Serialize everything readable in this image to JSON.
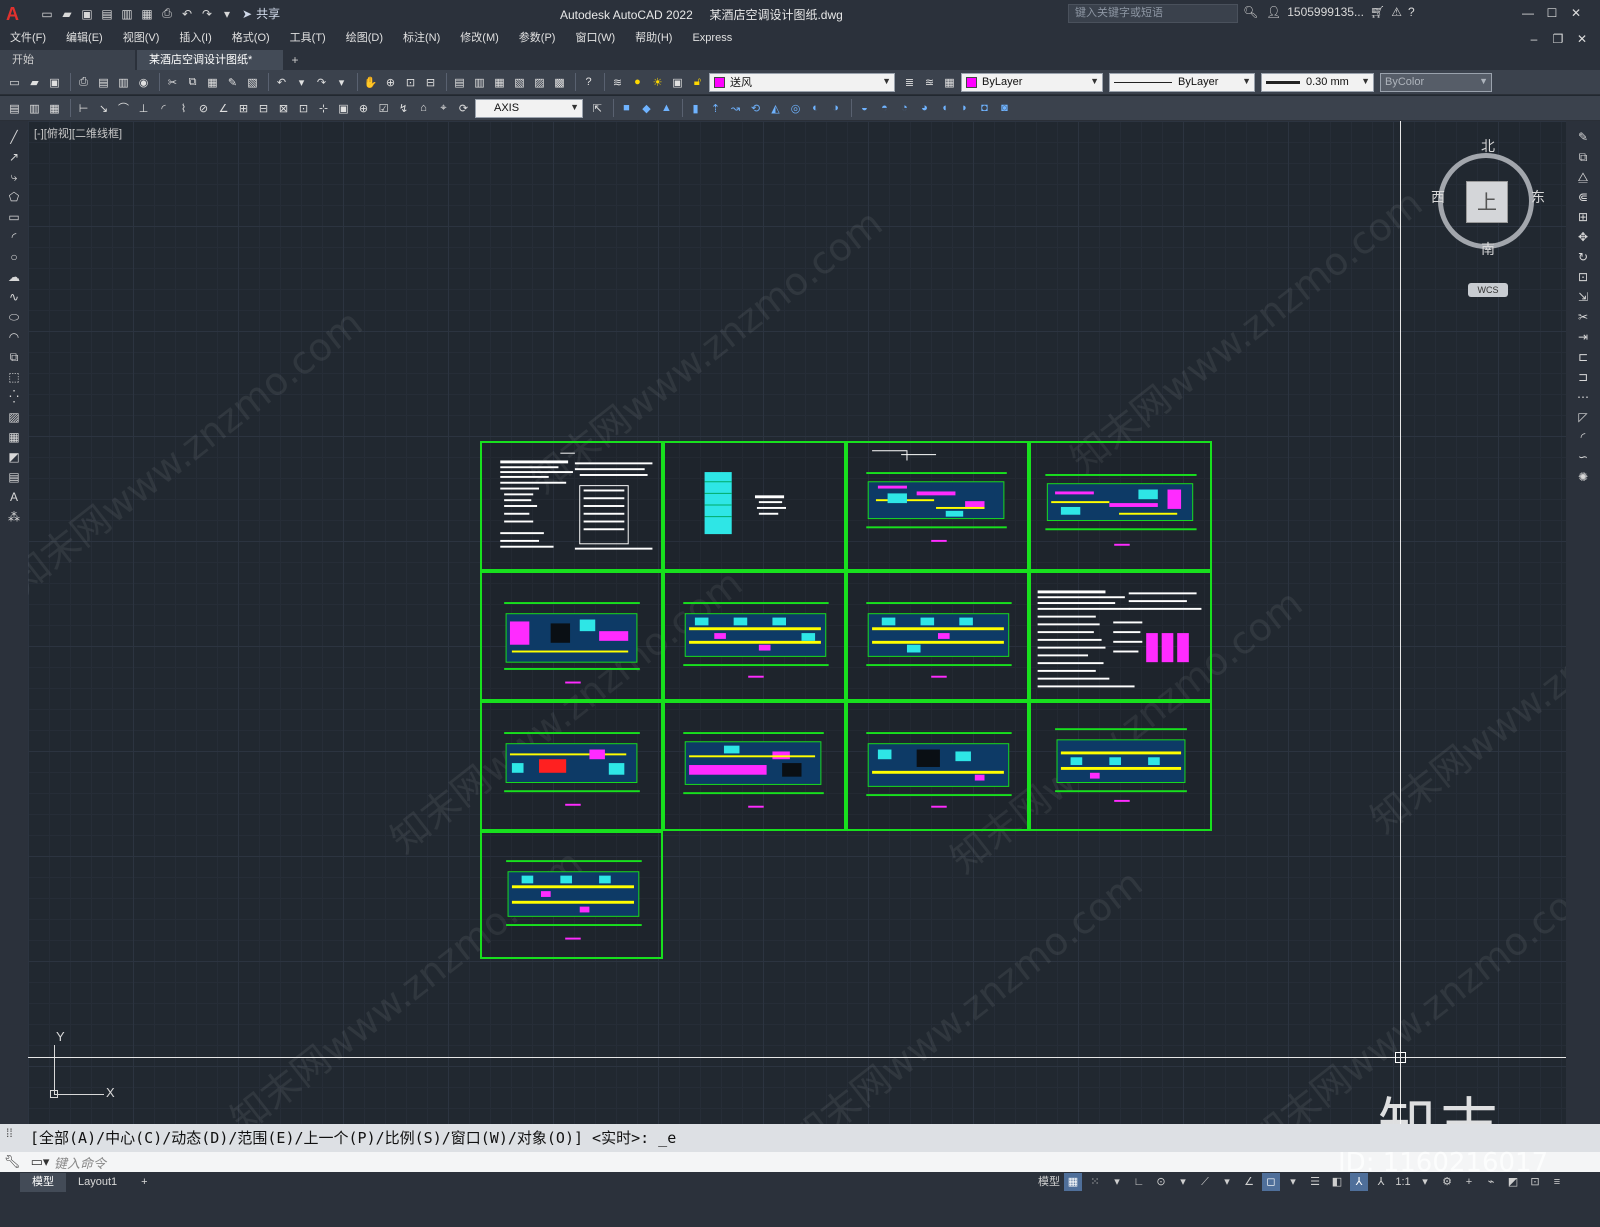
{
  "title_bar": {
    "app_title": "Autodesk AutoCAD 2022",
    "file_title": "某酒店空调设计图纸.dwg",
    "share_label": "共享",
    "search_placeholder": "键入关键字或短语",
    "user_name": "1505999135..."
  },
  "menu": {
    "items": [
      "文件(F)",
      "编辑(E)",
      "视图(V)",
      "插入(I)",
      "格式(O)",
      "工具(T)",
      "绘图(D)",
      "标注(N)",
      "修改(M)",
      "参数(P)",
      "窗口(W)",
      "帮助(H)",
      "Express"
    ]
  },
  "tabs": {
    "start": "开始",
    "active": "某酒店空调设计图纸*"
  },
  "properties": {
    "layer": "送风",
    "color": "ByLayer",
    "linetype": "ByLayer",
    "lineweight": "0.30 mm",
    "plotstyle": "ByColor",
    "dimstyle": "AXIS",
    "accent_color": "#ff00ff"
  },
  "viewport": {
    "label": "[-][俯视][二维线框]"
  },
  "viewcube": {
    "north": "北",
    "south": "南",
    "east": "东",
    "west": "西",
    "face": "上",
    "wcs": "WCS"
  },
  "ucs": {
    "x_label": "X",
    "y_label": "Y"
  },
  "command": {
    "history": "[全部(A)/中心(C)/动态(D)/范围(E)/上一个(P)/比例(S)/窗口(W)/对象(O)] <实时>: _e",
    "placeholder": "键入命令"
  },
  "status": {
    "model_tab": "模型",
    "layout_tab": "Layout1",
    "model_label": "模型",
    "scale": "1:1"
  },
  "watermarks": {
    "brand": "知末",
    "id": "ID: 1160216017",
    "site": "知末网www.znzmo.com"
  }
}
